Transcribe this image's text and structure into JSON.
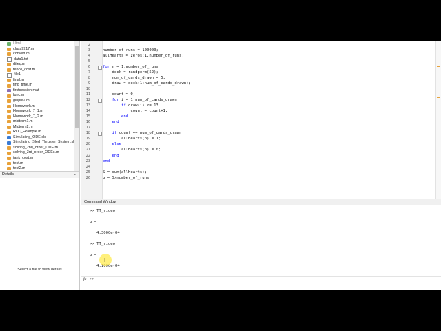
{
  "colors": {
    "keyword": "#0000ff",
    "highlight": "#ffeb50",
    "file_m": "#e8a23a"
  },
  "file_browser": {
    "items": [
      {
        "name": "Html",
        "icon": "folder-icon",
        "kind": "fig"
      },
      {
        "name": "class9917.m",
        "icon": "m-file-icon",
        "kind": "m"
      },
      {
        "name": "convert.m",
        "icon": "m-file-icon",
        "kind": "m"
      },
      {
        "name": "data1.txt",
        "icon": "text-file-icon",
        "kind": "txt"
      },
      {
        "name": "difeq.m",
        "icon": "m-file-icon",
        "kind": "m"
      },
      {
        "name": "fence_cost.m",
        "icon": "m-file-icon",
        "kind": "m"
      },
      {
        "name": "file1",
        "icon": "text-file-icon",
        "kind": "txt"
      },
      {
        "name": "final.m",
        "icon": "m-file-icon",
        "kind": "m"
      },
      {
        "name": "find_time.m",
        "icon": "m-file-icon",
        "kind": "m"
      },
      {
        "name": "firstsession.mat",
        "icon": "mat-file-icon",
        "kind": "mat"
      },
      {
        "name": "func.m",
        "icon": "m-file-icon",
        "kind": "m"
      },
      {
        "name": "ginput2.m",
        "icon": "m-file-icon",
        "kind": "m"
      },
      {
        "name": "Homework.m",
        "icon": "m-file-icon",
        "kind": "m"
      },
      {
        "name": "Homework_7_1.m",
        "icon": "m-file-icon",
        "kind": "m"
      },
      {
        "name": "Homework_7_2.m",
        "icon": "m-file-icon",
        "kind": "m"
      },
      {
        "name": "midterm1.m",
        "icon": "m-file-icon",
        "kind": "m"
      },
      {
        "name": "Midterm2.m",
        "icon": "m-file-icon",
        "kind": "m"
      },
      {
        "name": "RLC_Example.m",
        "icon": "m-file-icon",
        "kind": "m"
      },
      {
        "name": "Simulating_ODE.slx",
        "icon": "simulink-file-icon",
        "kind": "slx"
      },
      {
        "name": "Simulating_Sled_Thruster_System.slx",
        "icon": "simulink-file-icon",
        "kind": "slx"
      },
      {
        "name": "solving_2nd_order_ODE.m",
        "icon": "m-file-icon",
        "kind": "m"
      },
      {
        "name": "solving_3rd_order_ODEs.m",
        "icon": "m-file-icon",
        "kind": "m"
      },
      {
        "name": "tank_cost.m",
        "icon": "m-file-icon",
        "kind": "m"
      },
      {
        "name": "test.m",
        "icon": "m-file-icon",
        "kind": "m"
      },
      {
        "name": "test2.m",
        "icon": "m-file-icon",
        "kind": "m"
      }
    ]
  },
  "details": {
    "title": "Details",
    "empty_message": "Select a file to view details"
  },
  "editor": {
    "lines": [
      {
        "n": "2",
        "text": ""
      },
      {
        "n": "3",
        "text": "number_of_runs = 100000;"
      },
      {
        "n": "4",
        "text": "allHearts = zeros(1,number_of_runs);"
      },
      {
        "n": "5",
        "text": ""
      },
      {
        "n": "6",
        "text": "for n = 1:number_of_runs"
      },
      {
        "n": "7",
        "text": "    deck = randperm(52);"
      },
      {
        "n": "8",
        "text": "    num_of_cards_drawn = 5;"
      },
      {
        "n": "9",
        "text": "    draw = deck(1:num_of_cards_drawn);"
      },
      {
        "n": "10",
        "text": ""
      },
      {
        "n": "11",
        "text": "    count = 0;"
      },
      {
        "n": "12",
        "text": "    for i = 1:num_of_cards_drawn"
      },
      {
        "n": "13",
        "text": "        if draw(i) <= 13"
      },
      {
        "n": "14",
        "text": "            count = count+1;"
      },
      {
        "n": "15",
        "text": "        end"
      },
      {
        "n": "16",
        "text": "    end"
      },
      {
        "n": "17",
        "text": ""
      },
      {
        "n": "18",
        "text": "    if count == num_of_cards_drawn"
      },
      {
        "n": "19",
        "text": "        allHearts(n) = 1;"
      },
      {
        "n": "20",
        "text": "    else"
      },
      {
        "n": "21",
        "text": "        allHearts(n) = 0;"
      },
      {
        "n": "22",
        "text": "    end"
      },
      {
        "n": "23",
        "text": "end"
      },
      {
        "n": "24",
        "text": ""
      },
      {
        "n": "25",
        "text": "S = sum(allHearts);"
      },
      {
        "n": "26",
        "text": "p = S/number_of_runs"
      }
    ]
  },
  "command_window": {
    "title": "Command Window",
    "lines": [
      ">> TT_video",
      "",
      "p =",
      "",
      "   4.3000e-04",
      "",
      ">> TT_video",
      "",
      "p =",
      "",
      "   4.1000e-04"
    ],
    "fx_label": "fx",
    "prompt": ">>"
  }
}
